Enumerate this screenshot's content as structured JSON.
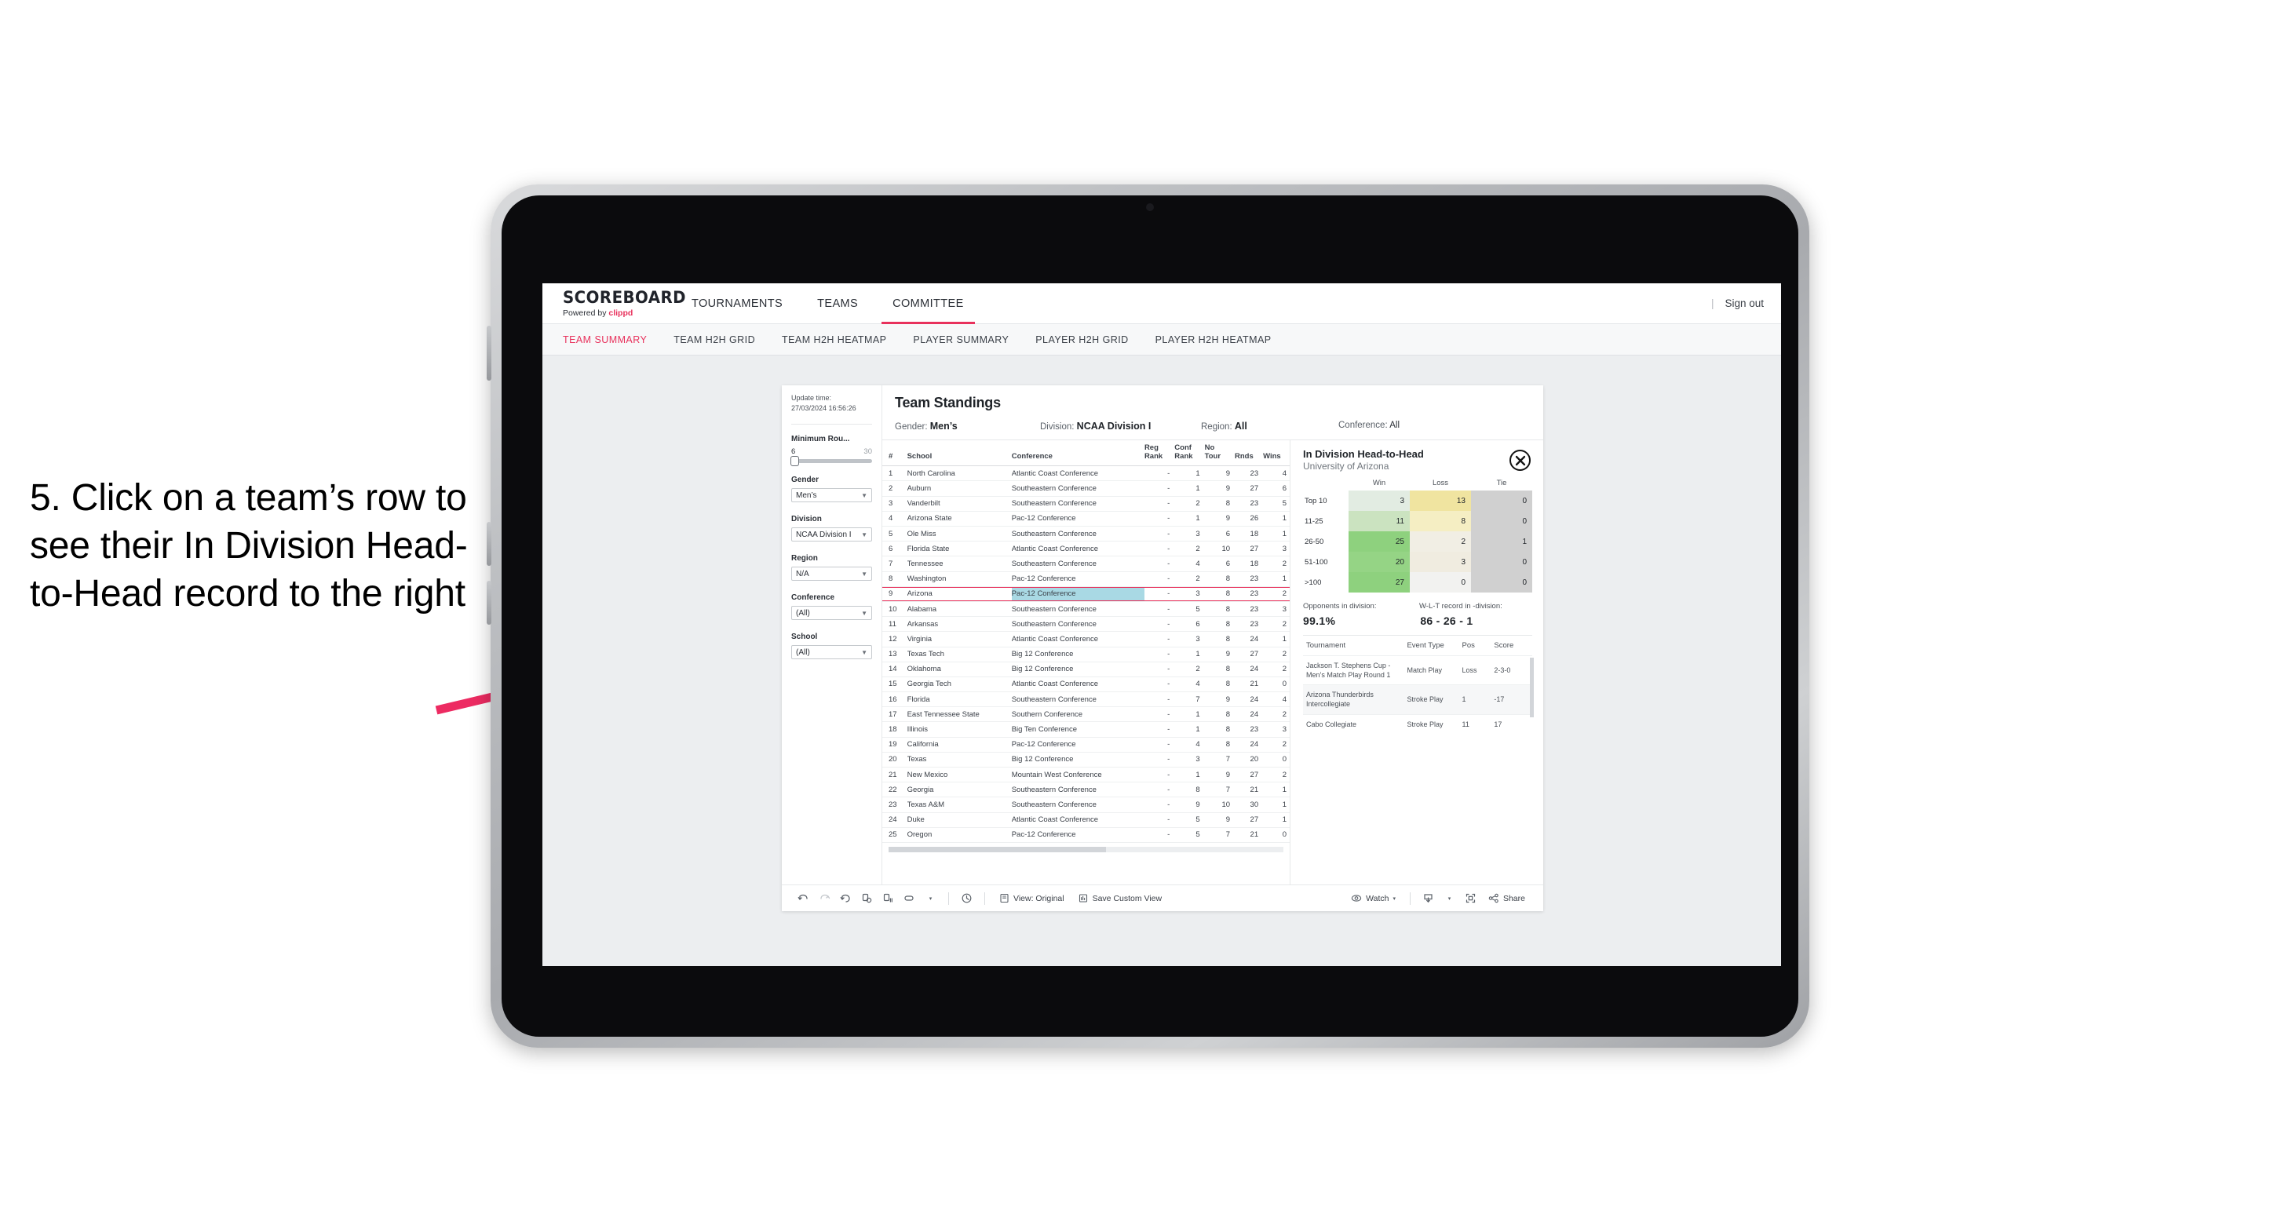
{
  "annotation": {
    "text": "5. Click on a team’s row to see their In Division Head-to-Head record to the right"
  },
  "app": {
    "brand_title": "SCOREBOARD",
    "brand_powered_prefix": "Powered by ",
    "brand_powered_name": "clippd",
    "accent_color": "#e8315c",
    "topnav": [
      {
        "label": "TOURNAMENTS",
        "active": false
      },
      {
        "label": "TEAMS",
        "active": false
      },
      {
        "label": "COMMITTEE",
        "active": true
      }
    ],
    "signout_divider": "|",
    "signout_label": "Sign out",
    "subnav": [
      {
        "label": "TEAM SUMMARY",
        "active": true
      },
      {
        "label": "TEAM H2H GRID",
        "active": false
      },
      {
        "label": "TEAM H2H HEATMAP",
        "active": false
      },
      {
        "label": "PLAYER SUMMARY",
        "active": false
      },
      {
        "label": "PLAYER H2H GRID",
        "active": false
      },
      {
        "label": "PLAYER H2H HEATMAP",
        "active": false
      }
    ]
  },
  "rail": {
    "update_label": "Update time:",
    "update_value": "27/03/2024 16:56:26",
    "min_rounds_label": "Minimum Rou...",
    "min_rounds_low": "6",
    "min_rounds_high": "30",
    "filters": [
      {
        "label": "Gender",
        "value": "Men’s"
      },
      {
        "label": "Division",
        "value": "NCAA Division I"
      },
      {
        "label": "Region",
        "value": "N/A"
      },
      {
        "label": "Conference",
        "value": "(All)"
      },
      {
        "label": "School",
        "value": "(All)"
      }
    ]
  },
  "standings": {
    "title": "Team Standings",
    "filters": [
      {
        "key": "Gender:",
        "value": "Men’s"
      },
      {
        "key": "Division:",
        "value": "NCAA Division I"
      },
      {
        "key": "Region:",
        "value": "All"
      },
      {
        "key": "Conference:",
        "value": "All"
      }
    ],
    "columns": [
      "#",
      "School",
      "Conference",
      "Reg Rank",
      "Conf Rank",
      "No Tour",
      "Rnds",
      "Wins"
    ],
    "rows": [
      {
        "n": "1",
        "school": "North Carolina",
        "conf": "Atlantic Coast Conference",
        "reg": "-",
        "cfr": "1",
        "tour": "9",
        "rnds": "23",
        "wins": "4",
        "sel": false
      },
      {
        "n": "2",
        "school": "Auburn",
        "conf": "Southeastern Conference",
        "reg": "-",
        "cfr": "1",
        "tour": "9",
        "rnds": "27",
        "wins": "6",
        "sel": false
      },
      {
        "n": "3",
        "school": "Vanderbilt",
        "conf": "Southeastern Conference",
        "reg": "-",
        "cfr": "2",
        "tour": "8",
        "rnds": "23",
        "wins": "5",
        "sel": false
      },
      {
        "n": "4",
        "school": "Arizona State",
        "conf": "Pac-12 Conference",
        "reg": "-",
        "cfr": "1",
        "tour": "9",
        "rnds": "26",
        "wins": "1",
        "sel": false
      },
      {
        "n": "5",
        "school": "Ole Miss",
        "conf": "Southeastern Conference",
        "reg": "-",
        "cfr": "3",
        "tour": "6",
        "rnds": "18",
        "wins": "1",
        "sel": false
      },
      {
        "n": "6",
        "school": "Florida State",
        "conf": "Atlantic Coast Conference",
        "reg": "-",
        "cfr": "2",
        "tour": "10",
        "rnds": "27",
        "wins": "3",
        "sel": false
      },
      {
        "n": "7",
        "school": "Tennessee",
        "conf": "Southeastern Conference",
        "reg": "-",
        "cfr": "4",
        "tour": "6",
        "rnds": "18",
        "wins": "2",
        "sel": false
      },
      {
        "n": "8",
        "school": "Washington",
        "conf": "Pac-12 Conference",
        "reg": "-",
        "cfr": "2",
        "tour": "8",
        "rnds": "23",
        "wins": "1",
        "sel": false
      },
      {
        "n": "9",
        "school": "Arizona",
        "conf": "Pac-12 Conference",
        "reg": "-",
        "cfr": "3",
        "tour": "8",
        "rnds": "23",
        "wins": "2",
        "sel": true
      },
      {
        "n": "10",
        "school": "Alabama",
        "conf": "Southeastern Conference",
        "reg": "-",
        "cfr": "5",
        "tour": "8",
        "rnds": "23",
        "wins": "3",
        "sel": false
      },
      {
        "n": "11",
        "school": "Arkansas",
        "conf": "Southeastern Conference",
        "reg": "-",
        "cfr": "6",
        "tour": "8",
        "rnds": "23",
        "wins": "2",
        "sel": false
      },
      {
        "n": "12",
        "school": "Virginia",
        "conf": "Atlantic Coast Conference",
        "reg": "-",
        "cfr": "3",
        "tour": "8",
        "rnds": "24",
        "wins": "1",
        "sel": false
      },
      {
        "n": "13",
        "school": "Texas Tech",
        "conf": "Big 12 Conference",
        "reg": "-",
        "cfr": "1",
        "tour": "9",
        "rnds": "27",
        "wins": "2",
        "sel": false
      },
      {
        "n": "14",
        "school": "Oklahoma",
        "conf": "Big 12 Conference",
        "reg": "-",
        "cfr": "2",
        "tour": "8",
        "rnds": "24",
        "wins": "2",
        "sel": false
      },
      {
        "n": "15",
        "school": "Georgia Tech",
        "conf": "Atlantic Coast Conference",
        "reg": "-",
        "cfr": "4",
        "tour": "8",
        "rnds": "21",
        "wins": "0",
        "sel": false
      },
      {
        "n": "16",
        "school": "Florida",
        "conf": "Southeastern Conference",
        "reg": "-",
        "cfr": "7",
        "tour": "9",
        "rnds": "24",
        "wins": "4",
        "sel": false
      },
      {
        "n": "17",
        "school": "East Tennessee State",
        "conf": "Southern Conference",
        "reg": "-",
        "cfr": "1",
        "tour": "8",
        "rnds": "24",
        "wins": "2",
        "sel": false
      },
      {
        "n": "18",
        "school": "Illinois",
        "conf": "Big Ten Conference",
        "reg": "-",
        "cfr": "1",
        "tour": "8",
        "rnds": "23",
        "wins": "3",
        "sel": false
      },
      {
        "n": "19",
        "school": "California",
        "conf": "Pac-12 Conference",
        "reg": "-",
        "cfr": "4",
        "tour": "8",
        "rnds": "24",
        "wins": "2",
        "sel": false
      },
      {
        "n": "20",
        "school": "Texas",
        "conf": "Big 12 Conference",
        "reg": "-",
        "cfr": "3",
        "tour": "7",
        "rnds": "20",
        "wins": "0",
        "sel": false
      },
      {
        "n": "21",
        "school": "New Mexico",
        "conf": "Mountain West Conference",
        "reg": "-",
        "cfr": "1",
        "tour": "9",
        "rnds": "27",
        "wins": "2",
        "sel": false
      },
      {
        "n": "22",
        "school": "Georgia",
        "conf": "Southeastern Conference",
        "reg": "-",
        "cfr": "8",
        "tour": "7",
        "rnds": "21",
        "wins": "1",
        "sel": false
      },
      {
        "n": "23",
        "school": "Texas A&M",
        "conf": "Southeastern Conference",
        "reg": "-",
        "cfr": "9",
        "tour": "10",
        "rnds": "30",
        "wins": "1",
        "sel": false
      },
      {
        "n": "24",
        "school": "Duke",
        "conf": "Atlantic Coast Conference",
        "reg": "-",
        "cfr": "5",
        "tour": "9",
        "rnds": "27",
        "wins": "1",
        "sel": false
      },
      {
        "n": "25",
        "school": "Oregon",
        "conf": "Pac-12 Conference",
        "reg": "-",
        "cfr": "5",
        "tour": "7",
        "rnds": "21",
        "wins": "0",
        "sel": false
      }
    ]
  },
  "detail": {
    "title": "In Division Head-to-Head",
    "subtitle": "University of Arizona",
    "close_icon": "close-icon",
    "opponents_label": "Opponents in division:",
    "opponents_value": "99.1%",
    "record_label": "W-L-T record in -division:",
    "record_value": "86 - 26 - 1",
    "tour_columns": [
      "Tournament",
      "Event Type",
      "Pos",
      "Score"
    ],
    "tournaments": [
      {
        "name": "Jackson T. Stephens Cup - Men’s Match Play Round 1",
        "type": "Match Play",
        "pos": "Loss",
        "score": "2-3-0"
      },
      {
        "name": "Arizona Thunderbirds Intercollegiate",
        "type": "Stroke Play",
        "pos": "1",
        "score": "-17"
      },
      {
        "name": "Cabo Collegiate",
        "type": "Stroke Play",
        "pos": "11",
        "score": "17"
      }
    ]
  },
  "chart_data": {
    "type": "heatmap",
    "title": "In Division Head-to-Head",
    "subtitle": "University of Arizona",
    "columns": [
      "Win",
      "Loss",
      "Tie"
    ],
    "rows": [
      "Top 10",
      "11-25",
      "26-50",
      "51-100",
      ">100"
    ],
    "values": [
      [
        3,
        13,
        0
      ],
      [
        11,
        8,
        0
      ],
      [
        25,
        2,
        1
      ],
      [
        20,
        3,
        0
      ],
      [
        27,
        0,
        0
      ]
    ],
    "cell_colors": [
      [
        "#e2ece2",
        "#f0e4a0",
        "#d0d0d0"
      ],
      [
        "#cbe3c0",
        "#f5eec3",
        "#d0d0d0"
      ],
      [
        "#8ed17e",
        "#f1eee4",
        "#d0d0d0"
      ],
      [
        "#95d485",
        "#f0ece0",
        "#d0d0d0"
      ],
      [
        "#8ed17e",
        "#f2f2f0",
        "#d0d0d0"
      ]
    ],
    "legend": "none",
    "grid": false
  },
  "footer": {
    "undo": "undo-icon",
    "redo": "redo-icon",
    "revert": "revert-icon",
    "refresh": "refresh-data-icon",
    "pause": "pause-auto-update-icon",
    "highlight": "highlight-icon",
    "highlight_caret": "▾",
    "history": "history-icon",
    "view_icon": "view-icon",
    "view_label": "View: Original",
    "save_icon": "save-view-icon",
    "save_label": "Save Custom View",
    "watch_icon": "watch-icon",
    "watch_label": "Watch",
    "watch_caret": "▾",
    "download_icon": "download-icon",
    "download_caret": "▾",
    "fullscreen_icon": "fullscreen-icon",
    "share_icon": "share-icon",
    "share_label": "Share"
  }
}
